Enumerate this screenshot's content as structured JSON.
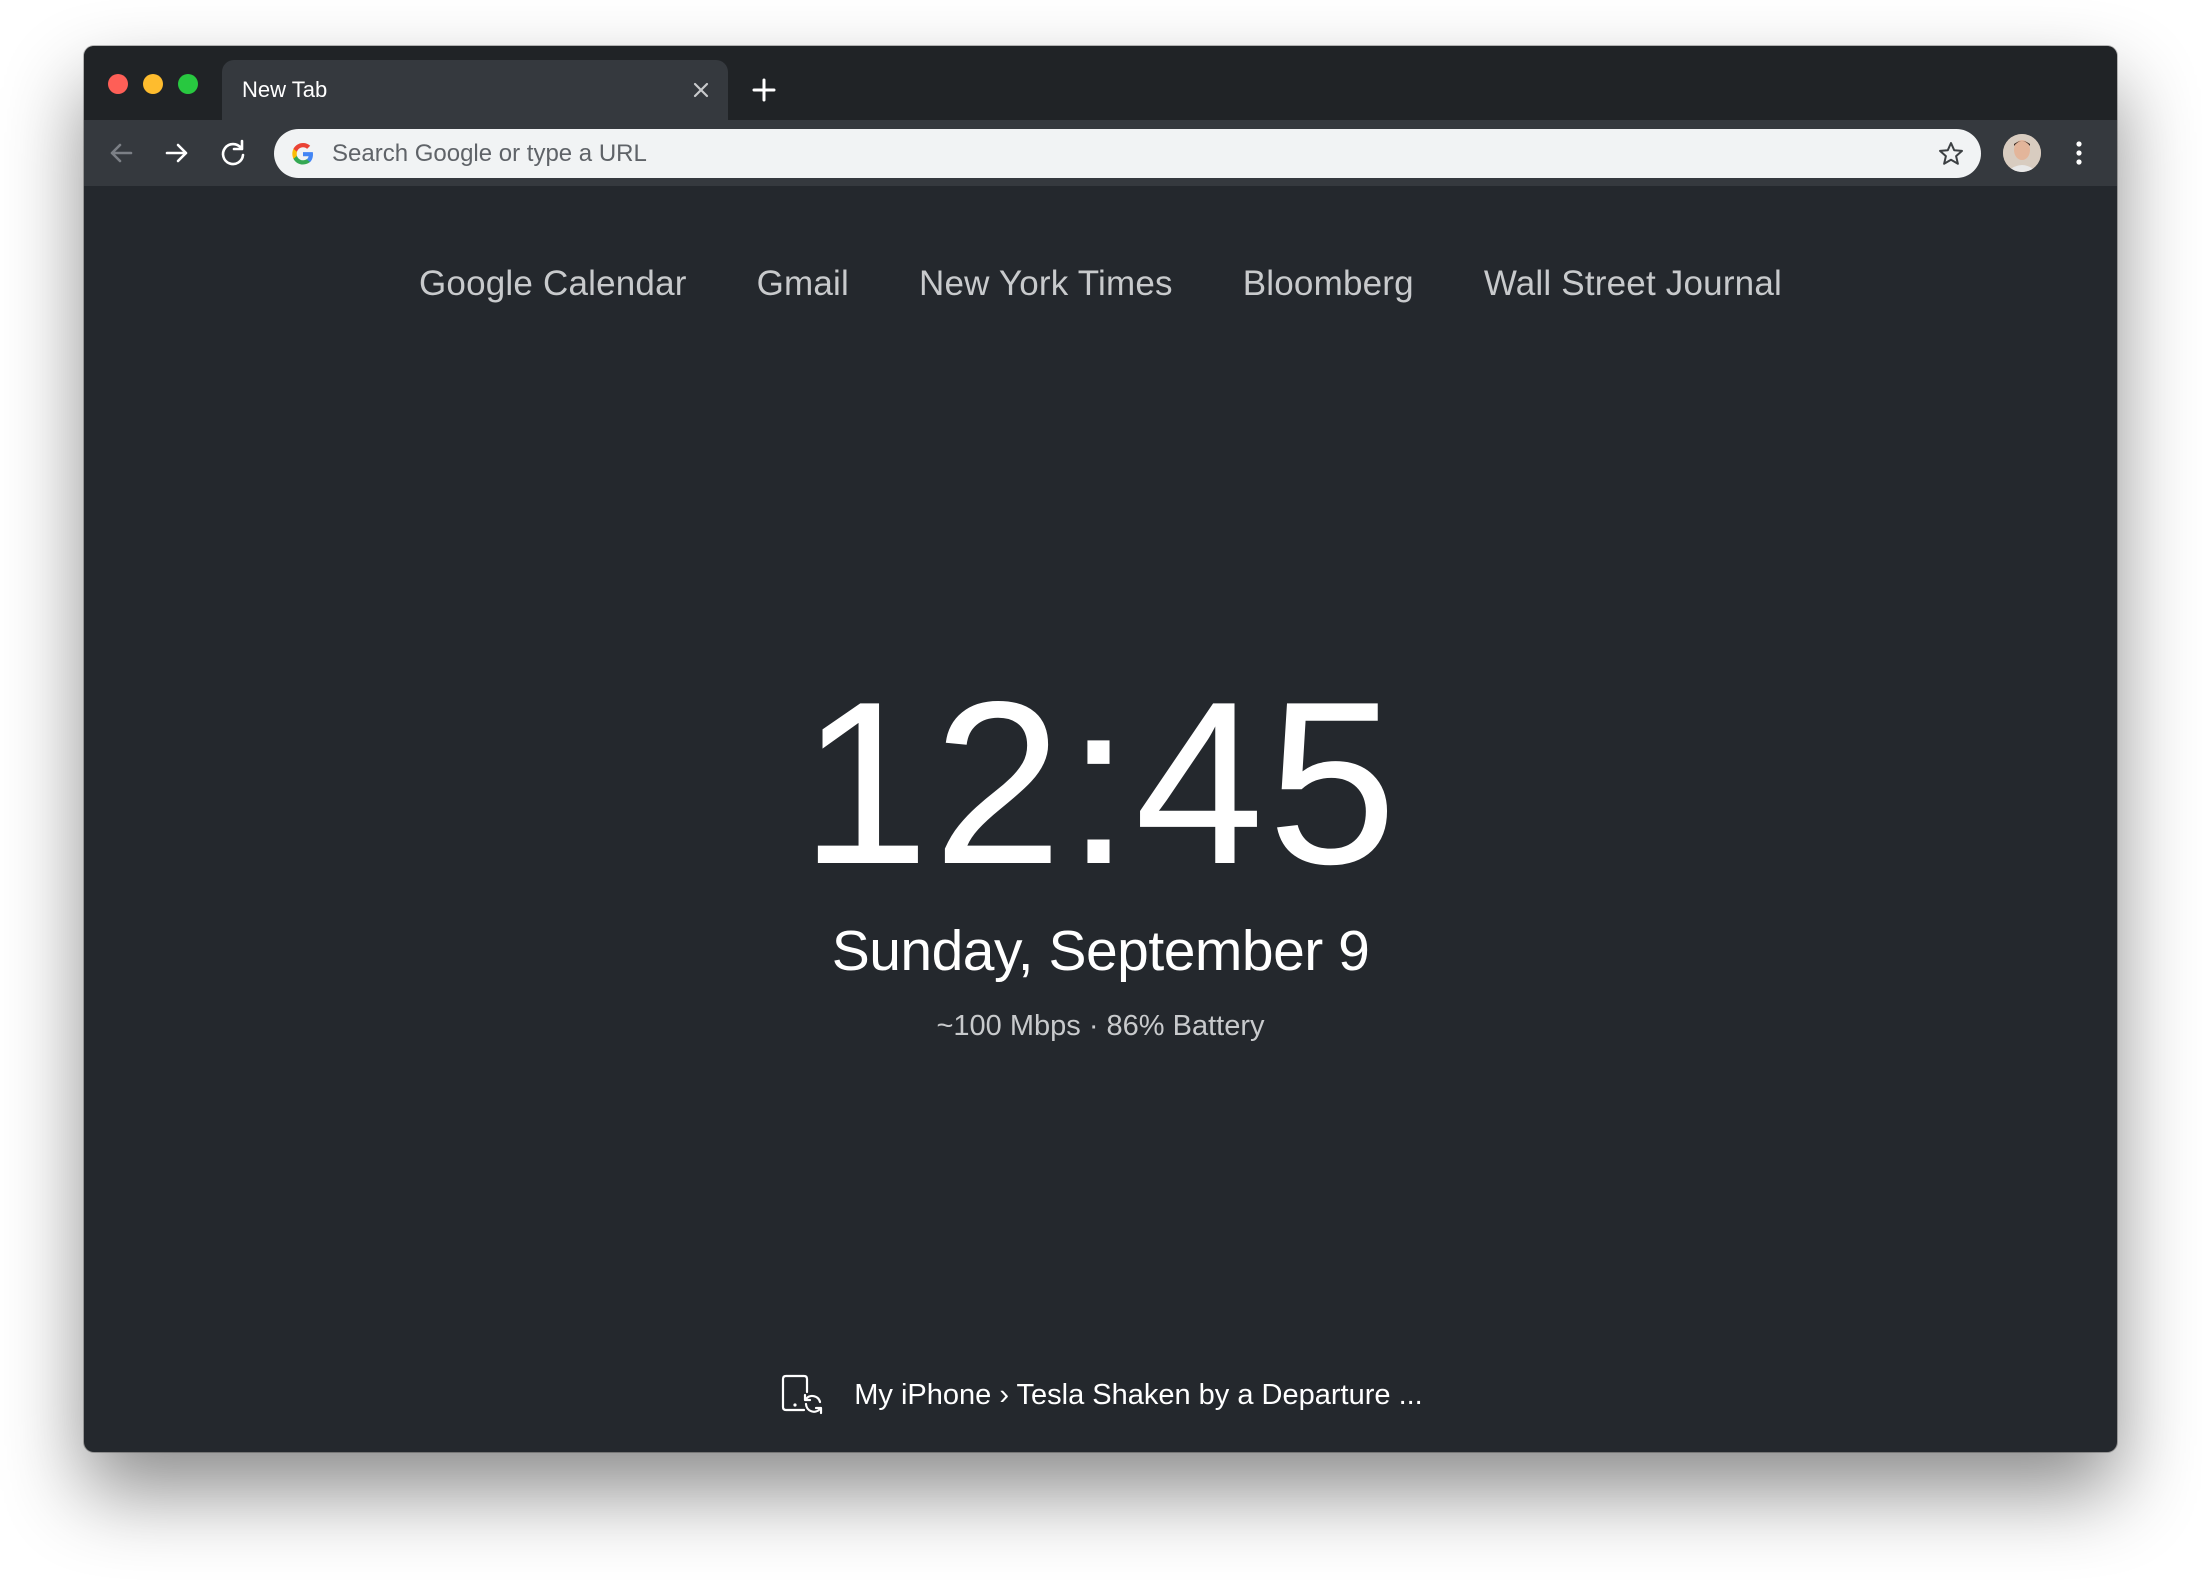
{
  "window": {
    "controls": [
      "close",
      "minimize",
      "zoom"
    ]
  },
  "tab": {
    "title": "New Tab",
    "close_icon": "close-icon",
    "new_tab_icon": "plus-icon"
  },
  "toolbar": {
    "back_icon": "arrow-left-icon",
    "forward_icon": "arrow-right-icon",
    "reload_icon": "reload-icon",
    "omnibox_placeholder": "Search Google or type a URL",
    "omnibox_value": "",
    "bookmark_icon": "star-icon",
    "menu_icon": "kebab-menu-icon"
  },
  "shortcuts": [
    {
      "label": "Google Calendar"
    },
    {
      "label": "Gmail"
    },
    {
      "label": "New York Times"
    },
    {
      "label": "Bloomberg"
    },
    {
      "label": "Wall Street Journal"
    }
  ],
  "clock": {
    "time": "12:45",
    "date": "Sunday, September 9",
    "status": "~100 Mbps · 86% Battery"
  },
  "device_tab": {
    "icon": "device-sync-icon",
    "text": "My iPhone › Tesla Shaken by a Departure ..."
  },
  "colors": {
    "background": "#24282d",
    "tabstrip": "#202326",
    "toolbar": "#35393e",
    "omnibox": "#f1f3f4",
    "shortcut_text": "#c8cacc",
    "clock_text": "#ffffff"
  }
}
